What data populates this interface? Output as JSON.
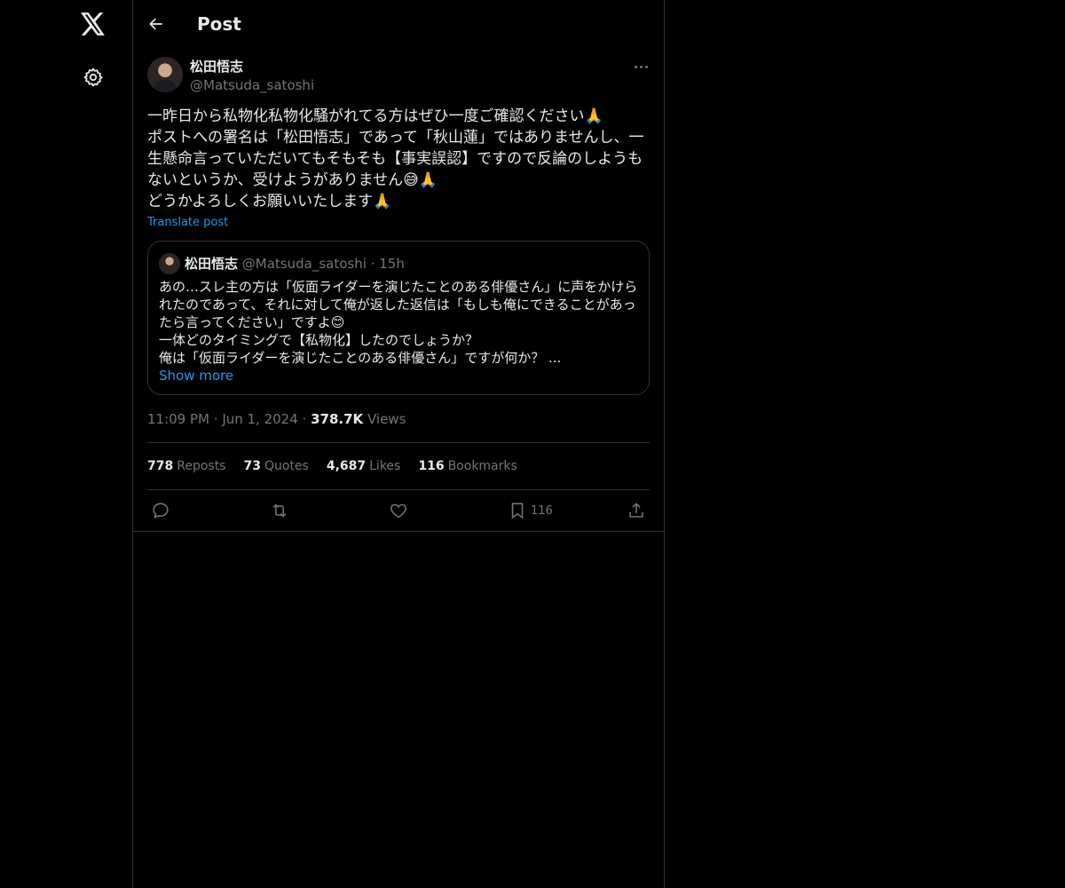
{
  "nav": {
    "logo_icon": "x-logo-icon",
    "settings_icon": "gear-icon"
  },
  "header": {
    "title": "Post",
    "back_icon": "arrow-left-icon"
  },
  "post": {
    "author_name": "松田悟志",
    "author_handle": "@Matsuda_satoshi",
    "body": "一昨日から私物化私物化騒がれてる方はぜひ一度ご確認ください🙏\nポストへの署名は「松田悟志」であって「秋山蓮」ではありませんし、一生懸命言っていただいてもそもそも【事実誤認】ですので反論のしようもないというか、受けようがありません😅🙏\nどうかよろしくお願いいたします🙏",
    "translate_label": "Translate post",
    "time": "11:09 PM",
    "date": "Jun 1, 2024",
    "views_count": "378.7K",
    "views_label": "Views"
  },
  "quote": {
    "author_name": "松田悟志",
    "author_handle": "@Matsuda_satoshi",
    "time_ago": "15h",
    "text": "あの…スレ主の方は「仮面ライダーを演じたことのある俳優さん」に声をかけられたのであって、それに対して俺が返した返信は「もしも俺にできることがあったら言ってください」ですよ😊\n一体どのタイミングで【私物化】したのでしょうか？\n俺は「仮面ライダーを演じたことのある俳優さん」ですが何か？ ...",
    "show_more": "Show more"
  },
  "stats": {
    "reposts_count": "778",
    "reposts_label": "Reposts",
    "quotes_count": "73",
    "quotes_label": "Quotes",
    "likes_count": "4,687",
    "likes_label": "Likes",
    "bookmarks_count": "116",
    "bookmarks_label": "Bookmarks"
  },
  "actions": {
    "bookmark_count": "116"
  },
  "colors": {
    "background": "#000000",
    "text": "#e7e9ea",
    "secondary": "#71767b",
    "accent": "#1d9bf0",
    "border": "#2f3336"
  }
}
